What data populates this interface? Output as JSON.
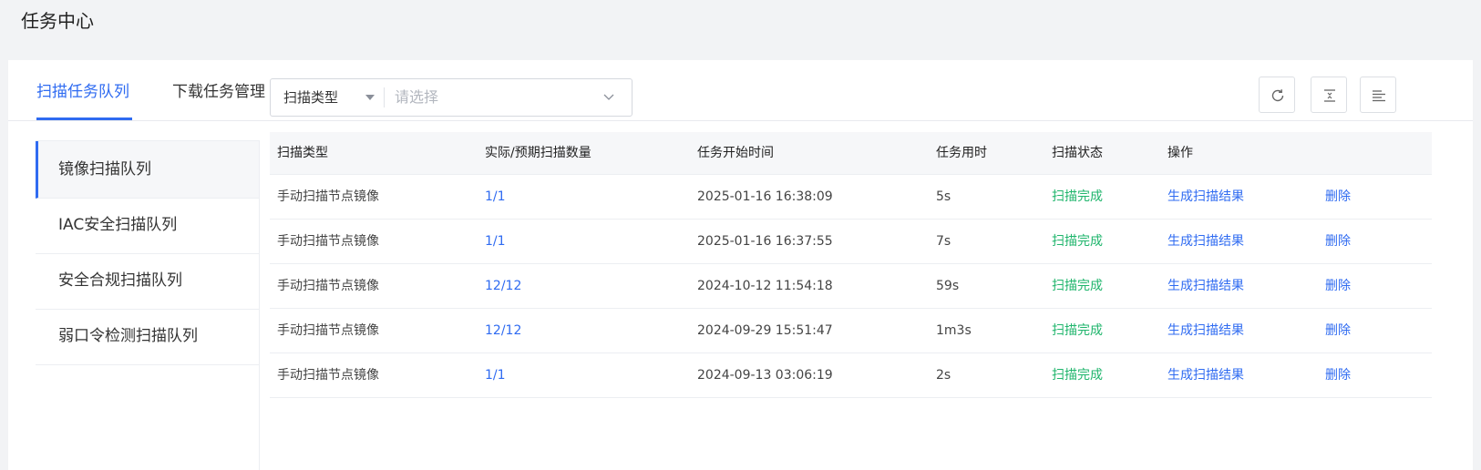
{
  "page_title": "任务中心",
  "tabs": [
    {
      "label": "扫描任务队列",
      "active": true
    },
    {
      "label": "下载任务管理",
      "active": false
    }
  ],
  "sidebar": {
    "items": [
      {
        "label": "镜像扫描队列",
        "active": true
      },
      {
        "label": "IAC安全扫描队列",
        "active": false
      },
      {
        "label": "安全合规扫描队列",
        "active": false
      },
      {
        "label": "弱口令检测扫描队列",
        "active": false
      }
    ]
  },
  "filter": {
    "type_label": "扫描类型",
    "placeholder": "请选择"
  },
  "toolbar": {
    "icons": [
      "refresh-icon",
      "expand-vertical-icon",
      "column-settings-icon"
    ]
  },
  "table": {
    "headers": [
      "扫描类型",
      "实际/预期扫描数量",
      "任务开始时间",
      "任务用时",
      "扫描状态",
      "操作"
    ],
    "rows": [
      {
        "type": "手动扫描节点镜像",
        "count": "1/1",
        "start": "2025-01-16 16:38:09",
        "duration": "5s",
        "status": "扫描完成",
        "action1": "生成扫描结果",
        "action2": "删除"
      },
      {
        "type": "手动扫描节点镜像",
        "count": "1/1",
        "start": "2025-01-16 16:37:55",
        "duration": "7s",
        "status": "扫描完成",
        "action1": "生成扫描结果",
        "action2": "删除"
      },
      {
        "type": "手动扫描节点镜像",
        "count": "12/12",
        "start": "2024-10-12 11:54:18",
        "duration": "59s",
        "status": "扫描完成",
        "action1": "生成扫描结果",
        "action2": "删除"
      },
      {
        "type": "手动扫描节点镜像",
        "count": "12/12",
        "start": "2024-09-29 15:51:47",
        "duration": "1m3s",
        "status": "扫描完成",
        "action1": "生成扫描结果",
        "action2": "删除"
      },
      {
        "type": "手动扫描节点镜像",
        "count": "1/1",
        "start": "2024-09-13 03:06:19",
        "duration": "2s",
        "status": "扫描完成",
        "action1": "生成扫描结果",
        "action2": "删除"
      }
    ]
  },
  "colors": {
    "accent": "#2f6bf1",
    "success": "#1fb56c",
    "page_bg": "#f2f3f5"
  }
}
